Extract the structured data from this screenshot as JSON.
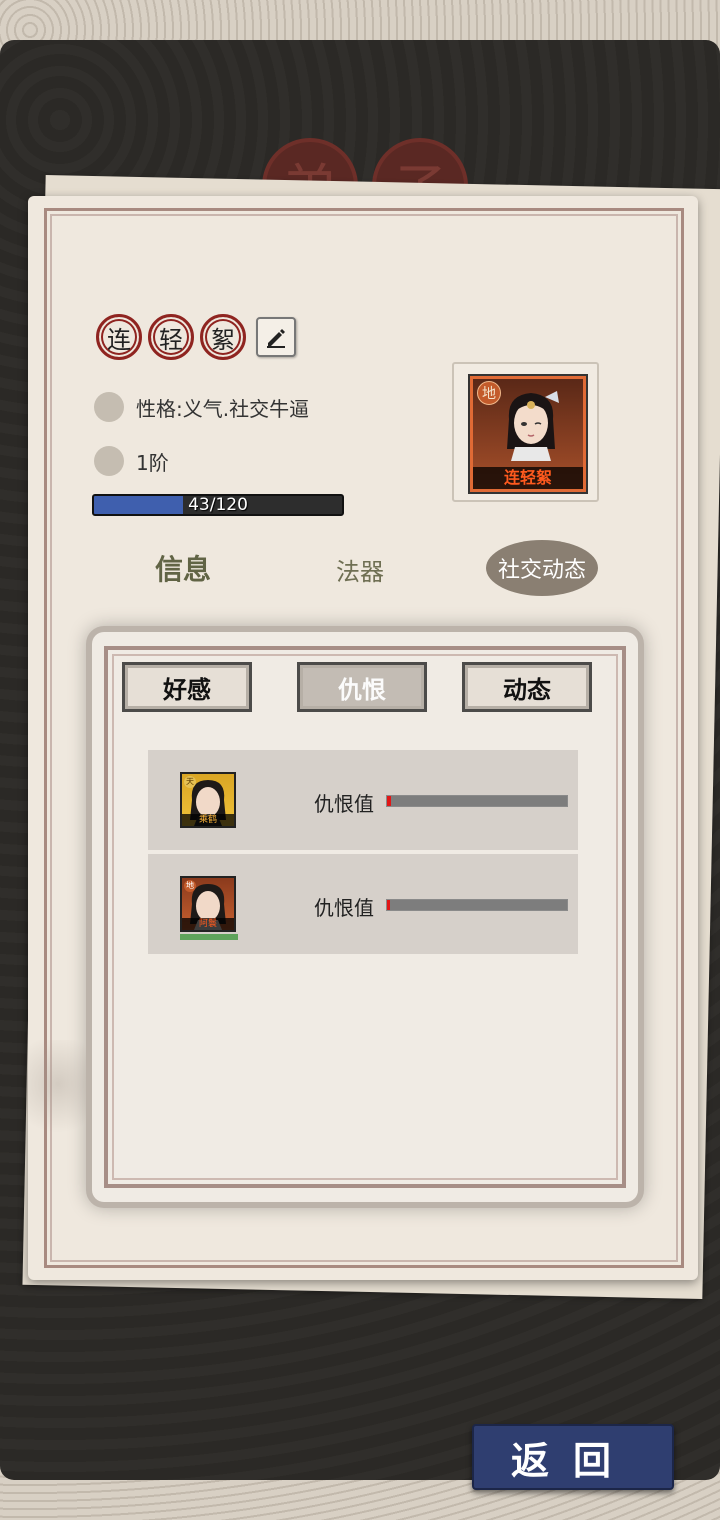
{
  "header": {
    "title_chars": [
      "弟",
      "子"
    ]
  },
  "disciple": {
    "name_chars": [
      "连",
      "轻",
      "絮"
    ],
    "personality": "性格:义气.社交牛逼",
    "rank": "1阶",
    "exp_text": "43/120",
    "exp_progress": 0.358,
    "portrait_grade": "地",
    "portrait_name": "连轻絮"
  },
  "tabs": {
    "info": "信息",
    "artifact": "法器",
    "social": "社交动态"
  },
  "subtabs": {
    "favor": "好感",
    "hatred": "仇恨",
    "dynamics": "动态"
  },
  "relations": [
    {
      "name": "乘鹤",
      "grade": "天",
      "label": "仇恨值",
      "value": 0.02
    },
    {
      "name": "阿鬟",
      "grade": "地",
      "label": "仇恨值",
      "value": 0.01
    }
  ],
  "footer": {
    "return_label": "返回"
  },
  "colors": {
    "accent_blue": "#2f3e70",
    "exp_fill": "#3f5fae",
    "seal_red": "#8f2420",
    "hate_red": "#e11616"
  }
}
